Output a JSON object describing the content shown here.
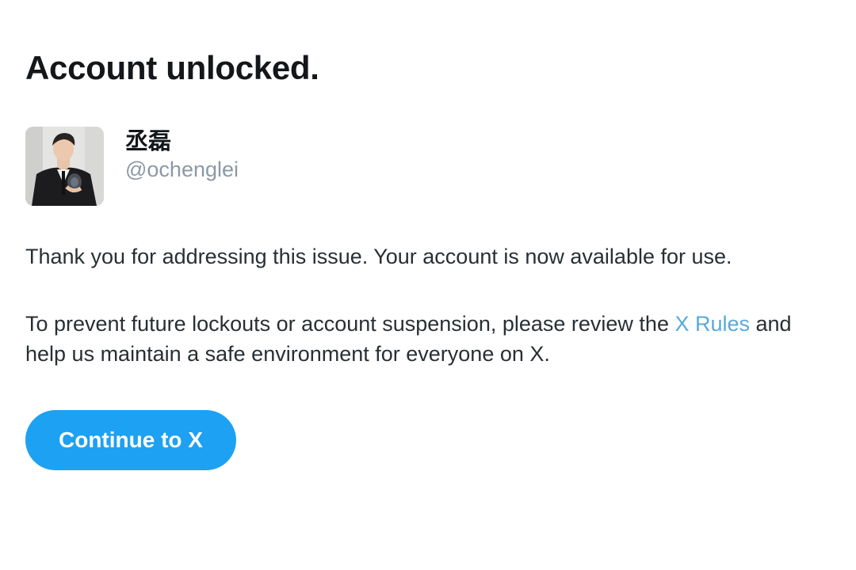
{
  "page": {
    "title": "Account unlocked."
  },
  "profile": {
    "display_name": "丞磊",
    "handle": "@ochenglei",
    "avatar_icon": "user-photo"
  },
  "message": {
    "paragraph_1": "Thank you for addressing this issue. Your account is now available for use.",
    "paragraph_2_before_link": "To prevent future lockouts or account suspension, please review the ",
    "rules_link": "X Rules",
    "paragraph_2_after_link": " and help us maintain a safe environment for everyone on X."
  },
  "actions": {
    "continue_label": "Continue to X"
  },
  "colors": {
    "accent": "#1da1f2",
    "link": "#59a9dc",
    "secondary_text": "#8a99a6"
  }
}
